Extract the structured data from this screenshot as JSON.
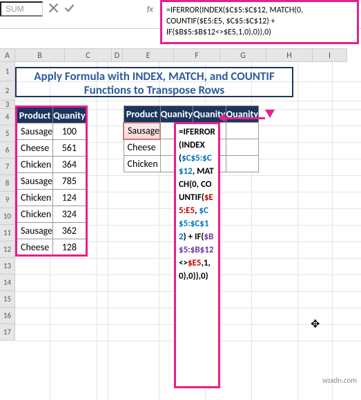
{
  "name_box": "SUM",
  "formula_bar": "=IFERROR(INDEX($C$5:$C$12, MATCH(0, COUNTIF($E5:E5, $C$5:$C$12) + IF($B$5:$B$12<>$E5,1,0),0)),0)",
  "fx_label": "fx",
  "columns": [
    "A",
    "B",
    "C",
    "D",
    "E",
    "F",
    "G",
    "H",
    "I"
  ],
  "rows": [
    "1",
    "2",
    "3",
    "4",
    "5",
    "6",
    "7",
    "8",
    "9",
    "10",
    "11",
    "12",
    "13",
    "14",
    "15",
    "16",
    "17"
  ],
  "title": "Apply Formula with INDEX, MATCH, and COUNTIF Functions to Transpose Rows",
  "table1": {
    "headers": [
      "Product",
      "Quanity"
    ],
    "rows": [
      [
        "Sausage",
        "100"
      ],
      [
        "Cheese",
        "561"
      ],
      [
        "Chicken",
        "364"
      ],
      [
        "Sausage",
        "785"
      ],
      [
        "Chicken",
        "124"
      ],
      [
        "Chicken",
        "324"
      ],
      [
        "Sausage",
        "362"
      ],
      [
        "Cheese",
        "128"
      ]
    ]
  },
  "table2": {
    "headers": [
      "Product",
      "Quanity",
      "Quanity",
      "Quanity"
    ],
    "col1": [
      "Sausage",
      "Cheese",
      "Chicken"
    ]
  },
  "formula_cell_parts": [
    {
      "cls": "bk",
      "t": "=IFERROR("
    },
    {
      "cls": "bk",
      "t": "INDEX("
    },
    {
      "cls": "bl",
      "t": "$C$5:$C$12"
    },
    {
      "cls": "bk",
      "t": ", MATCH(0, COUNTIF("
    },
    {
      "cls": "rd",
      "t": "$E5:E5"
    },
    {
      "cls": "bk",
      "t": ", "
    },
    {
      "cls": "bl",
      "t": "$C$5:$C$12"
    },
    {
      "cls": "bk",
      "t": ") + IF("
    },
    {
      "cls": "pu",
      "t": "$B$5:$B$12"
    },
    {
      "cls": "bk",
      "t": "<>"
    },
    {
      "cls": "rd",
      "t": "$E5"
    },
    {
      "cls": "bk",
      "t": ",1,0),0)),0)"
    }
  ],
  "watermark": "wsxdn.com",
  "chart_data": {
    "type": "table",
    "title": "Apply Formula with INDEX, MATCH, and COUNTIF Functions to Transpose Rows",
    "source_table": {
      "columns": [
        "Product",
        "Quanity"
      ],
      "rows": [
        [
          "Sausage",
          100
        ],
        [
          "Cheese",
          561
        ],
        [
          "Chicken",
          364
        ],
        [
          "Sausage",
          785
        ],
        [
          "Chicken",
          124
        ],
        [
          "Chicken",
          324
        ],
        [
          "Sausage",
          362
        ],
        [
          "Cheese",
          128
        ]
      ]
    },
    "transposed_headers": [
      "Product",
      "Quanity",
      "Quanity",
      "Quanity"
    ],
    "transposed_row_labels": [
      "Sausage",
      "Cheese",
      "Chicken"
    ],
    "formula": "=IFERROR(INDEX($C$5:$C$12, MATCH(0, COUNTIF($E5:E5, $C$5:$C$12) + IF($B$5:$B$12<>$E5,1,0),0)),0)"
  }
}
